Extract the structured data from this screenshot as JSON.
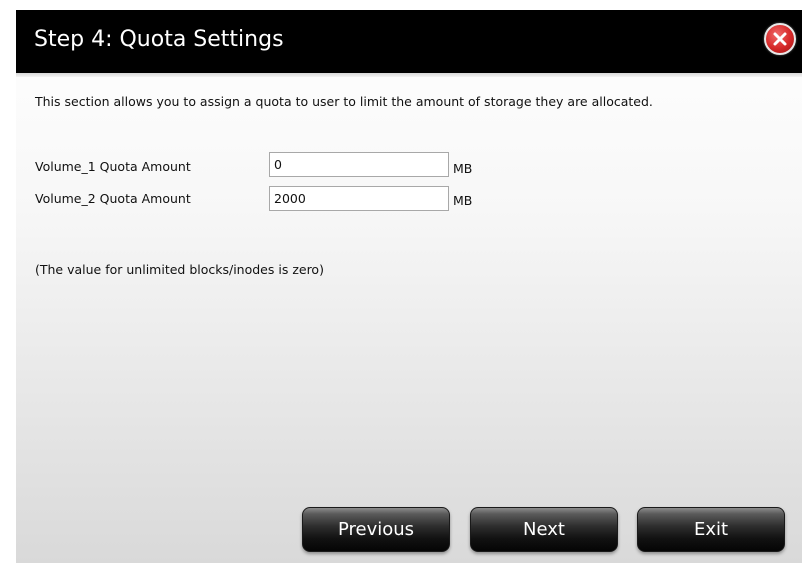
{
  "dialog": {
    "title": "Step 4: Quota Settings",
    "close_icon": "close-x-icon",
    "close_color": "#d62828",
    "description": "This section allows you to assign a quota to user to limit the amount of storage they are allocated.",
    "quotas": [
      {
        "label": "Volume_1 Quota Amount",
        "value": "0",
        "unit": "MB"
      },
      {
        "label": "Volume_2 Quota Amount",
        "value": "2000",
        "unit": "MB"
      }
    ],
    "note": "(The value for unlimited blocks/inodes is zero)"
  },
  "buttons": {
    "previous": "Previous",
    "next": "Next",
    "exit": "Exit"
  }
}
